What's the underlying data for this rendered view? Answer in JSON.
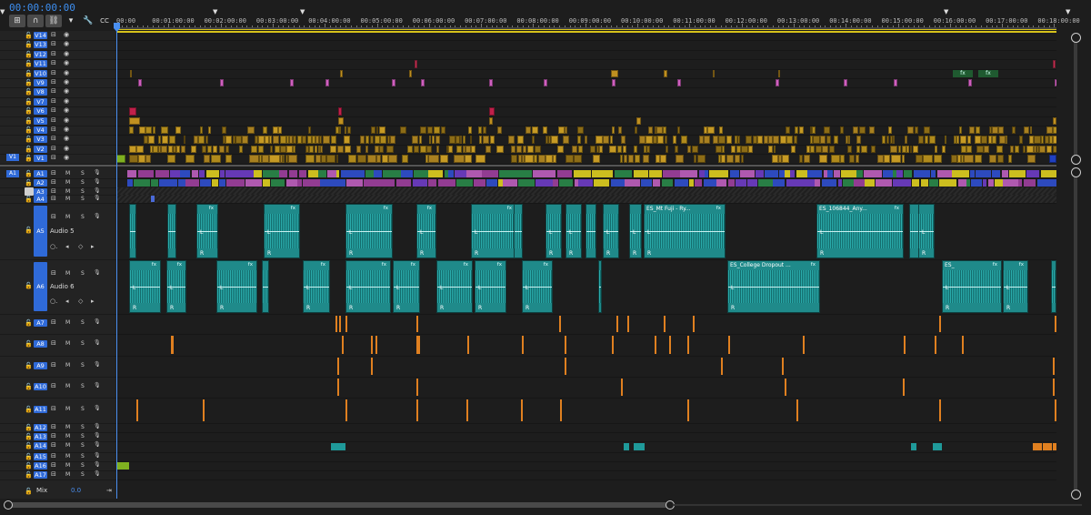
{
  "timecode": "00:00:00:00",
  "ruler": {
    "labels": [
      "00:00",
      "00:01:00:00",
      "00:02:00:00",
      "00:03:00:00",
      "00:04:00:00",
      "00:05:00:00",
      "00:06:00:00",
      "00:07:00:00",
      "00:08:00:00",
      "00:09:00:00",
      "00:10:00:00",
      "00:11:00:00",
      "00:12:00:00",
      "00:13:00:00",
      "00:14:00:00",
      "00:15:00:00",
      "00:16:00:00",
      "00:17:00:00",
      "00:18:00:00"
    ]
  },
  "video_tracks": [
    "V14",
    "V13",
    "V12",
    "V11",
    "V10",
    "V9",
    "V8",
    "V7",
    "V6",
    "V5",
    "V4",
    "V3",
    "V2",
    "V1"
  ],
  "audio_tracks": [
    "A1",
    "A2",
    "A3",
    "A4",
    "A5",
    "A6",
    "A7",
    "A8",
    "A9",
    "A10",
    "A11",
    "A12",
    "A13",
    "A14",
    "A15",
    "A16",
    "A17"
  ],
  "source_patch": {
    "video": "V1",
    "audio": "A1"
  },
  "audio_names": {
    "a5": "Audio 5",
    "a6": "Audio 6"
  },
  "mute_label": "M",
  "solo_label": "S",
  "mix": {
    "label": "Mix",
    "value": "0.0"
  },
  "clips": {
    "a5_c1_label": "ES_Mt Fuji - Ry...",
    "a5_c2_label": "ES_106844_Any...",
    "a6_c1_label": "ES_College Dropout ...",
    "a6_c2_label": "ES_",
    "fx_label": "fx",
    "left_label": "L",
    "right_label": "R"
  },
  "colors": {
    "accent": "#2f6ad8",
    "audio_clip": "#1f8a8a",
    "video_clip": "#c09020",
    "pink": "#d060c0",
    "orange": "#e08020",
    "yellow": "#e0d020"
  }
}
